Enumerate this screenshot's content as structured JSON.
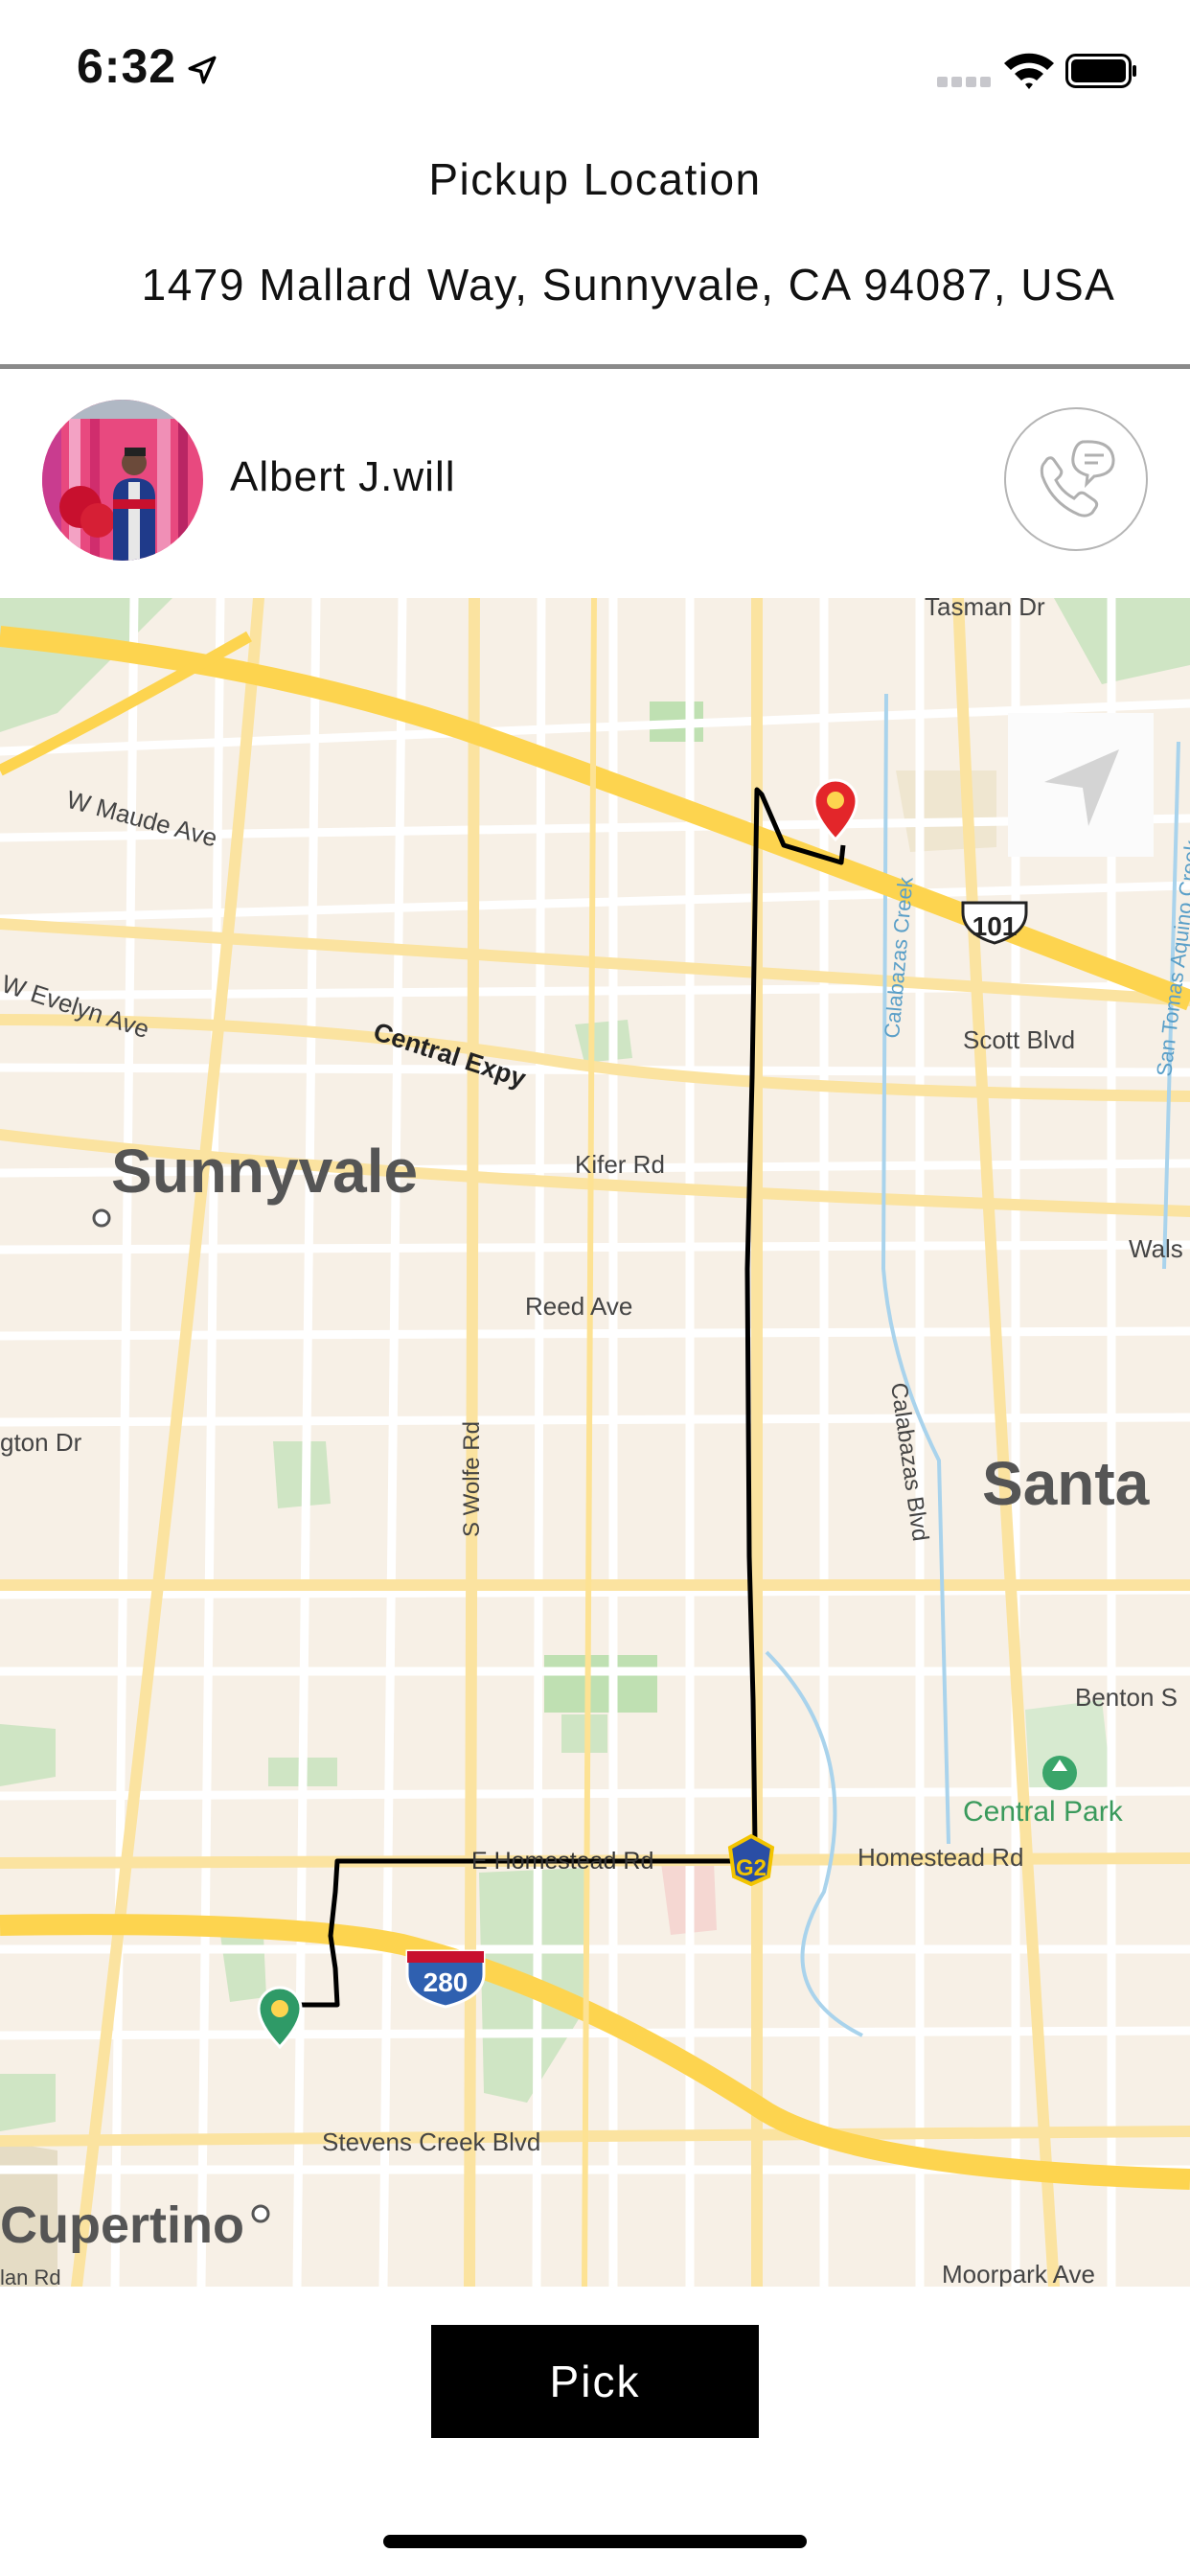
{
  "status_bar": {
    "time": "6:32"
  },
  "pickup": {
    "title": "Pickup Location",
    "address": "1479 Mallard Way, Sunnyvale, CA 94087, USA"
  },
  "driver": {
    "name": "Albert J.will"
  },
  "map": {
    "labels": {
      "tasman": "Tasman Dr",
      "w_maude": "W Maude Ave",
      "w_evelyn": "W Evelyn Ave",
      "central_expy": "Central Expy",
      "sunnyvale": "Sunnyvale",
      "kifer": "Kifer Rd",
      "reed": "Reed Ave",
      "arlington": "gton Dr",
      "wolfe": "S Wolfe Rd",
      "calabazas_creek": "Calabazas Creek",
      "calabazas_blvd": "Calabazas Blvd",
      "scott": "Scott Blvd",
      "san_tomas": "San Tomas Aquino Creek",
      "walsh": "Wals",
      "santa": "Santa",
      "benton": "Benton S",
      "central_park": "Central Park",
      "e_homestead": "E Homestead Rd",
      "homestead": "Homestead Rd",
      "stevens_creek": "Stevens Creek Blvd",
      "cupertino": "Cupertino",
      "moorpark": "Moorpark Ave",
      "bottom_left": "lan Rd"
    },
    "shields": {
      "us101": "101",
      "i280": "280",
      "g2": "G2"
    }
  },
  "actions": {
    "pick_label": "Pick"
  },
  "colors": {
    "accent": "#000000",
    "map_background": "#f7f0e6",
    "highway": "#fdd44f",
    "route": "#000000",
    "pickup_pin": "#e3262a",
    "dropoff_pin": "#2f9a67"
  }
}
